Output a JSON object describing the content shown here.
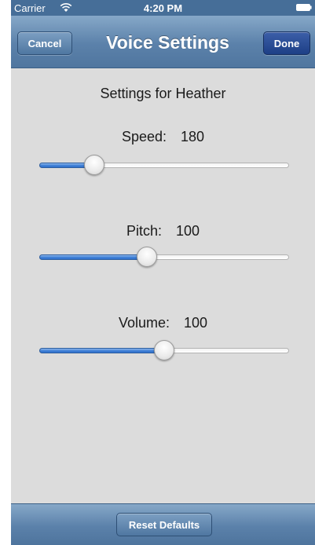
{
  "status_bar": {
    "carrier": "Carrier",
    "time": "4:20 PM",
    "wifi_icon": "wifi-icon",
    "battery_icon": "battery-icon"
  },
  "nav": {
    "title": "Voice Settings",
    "cancel_label": "Cancel",
    "done_label": "Done"
  },
  "content": {
    "heading": "Settings for Heather"
  },
  "settings": [
    {
      "label": "Speed:",
      "value": "180",
      "level": 0.22
    },
    {
      "label": "Pitch:",
      "value": "100",
      "level": 0.43
    },
    {
      "label": "Volume:",
      "value": "100",
      "level": 0.5
    }
  ],
  "toolbar": {
    "reset_label": "Reset Defaults"
  },
  "colors": {
    "bar_blue": "#5b81aa",
    "done_blue": "#1d3f86",
    "slider_fill": "#3f80d6",
    "background": "#dcdcdc"
  }
}
